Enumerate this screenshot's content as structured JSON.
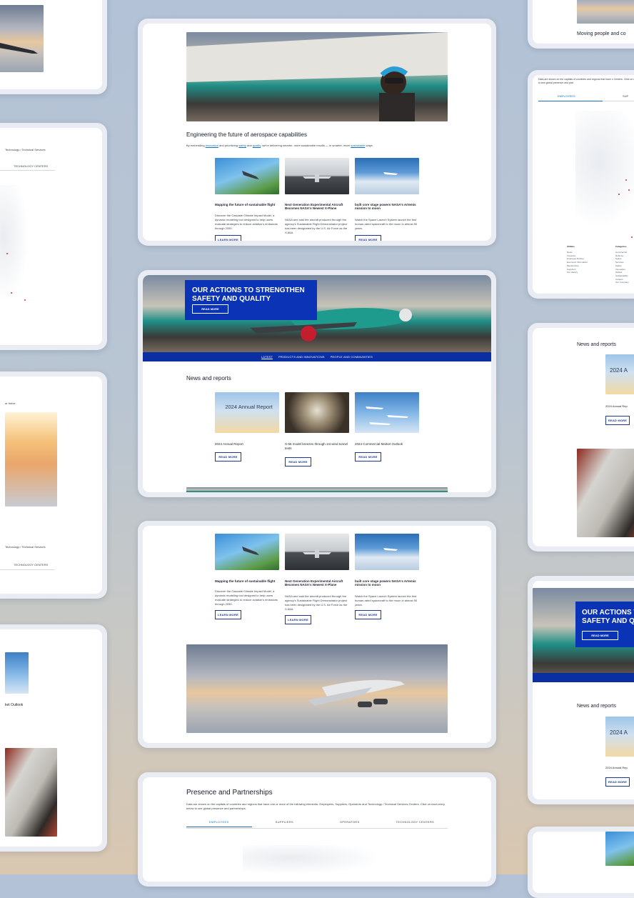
{
  "colors": {
    "brand_blue": "#0b33b6",
    "link_blue": "#1b6fb5",
    "button_border": "#1b3a8f"
  },
  "card1": {
    "title": "Engineering the future of aerospace capabilities",
    "intro_pre": "By embedding ",
    "intro_link1": "innovation",
    "intro_mid1": " and prioritizing ",
    "intro_link2": "safety",
    "intro_mid2": " and ",
    "intro_link3": "quality",
    "intro_mid3": ", we're delivering smarter, more sustainable results — in smarter, more ",
    "intro_link4": "sustainable",
    "intro_end": " ways.",
    "articles": [
      {
        "title": "Mapping the future of sustainable flight",
        "body": "Discover the Cascade Climate Impact Model, a dynamic modeling tool designed to help users evaluate strategies to reduce aviation's emissions through 2050.",
        "button": "LEARN MORE"
      },
      {
        "title": "Next Generation Experimental Aircraft Becomes NASA's Newest X-Plane",
        "body": "NASA and said the aircraft produced through the agency's Sustainable Flight Demonstrator project has been designated by the U.S. Air Force as the X-66A.",
        "button": "LEARN MORE"
      },
      {
        "title": "built core stage powers NASA's Artemis mission to moon",
        "body": "Watch the Space Launch System launch the first human-rated spacecraft to the moon in almost 50 years.",
        "button": "READ MORE"
      }
    ]
  },
  "card2": {
    "hero_title": "OUR ACTIONS TO STRENGTHEN SAFETY AND QUALITY",
    "hero_button": "READ MORE",
    "tabs": [
      "LATEST",
      "PRODUCTS AND INNOVATIONS",
      "PEOPLE AND COMMUNITIES"
    ],
    "section_title": "News and reports",
    "items": [
      {
        "title": "2024 Annual Report",
        "image_text": "2024 Annual Report",
        "button": "READ MORE"
      },
      {
        "title": "X-66 model breezes through 1st wind tunnel tests",
        "button": "READ MORE"
      },
      {
        "title": "2024 Commercial Market Outlook",
        "button": "READ MORE"
      }
    ]
  },
  "card3": {
    "articles": [
      {
        "title": "Mapping the future of sustainable flight",
        "body": "Discover the Cascade Climate Impact Model, a dynamic modeling tool designed to help users evaluate strategies to reduce aviation's emissions through 2050.",
        "button": "LEARN MORE"
      },
      {
        "title": "Next Generation Experimental Aircraft Becomes NASA's Newest X-Plane",
        "body": "NASA and said the aircraft produced through the agency's Sustainable Flight Demonstrator project has been designated by the U.S. Air Force as the X-66A.",
        "button": "LEARN MORE"
      },
      {
        "title": "built core stage powers NASA's Artemis mission to moon",
        "body": "Watch the Space Launch System launch the first human-rated spacecraft to the moon in almost 50 years.",
        "button": "READ MORE"
      }
    ]
  },
  "card4": {
    "title": "Presence and Partnerships",
    "desc": "Data are shown on the capitals of countries and regions that have one or more of the following elements: Employees, Suppliers, Operators and Technology / Technical Services Centers. Click on each entry below to see global presence and partnerships.",
    "tabs": [
      "EMPLOYEES",
      "SUPPLIERS",
      "OPERATORS",
      "TECHNOLOGY CENTERS"
    ]
  },
  "left": {
    "tech_label": "Technology / Technical Services",
    "tech_tab": "TECHNOLOGY CENTERS",
    "thrive": "ar thrive.",
    "tech_label2": "Technology / Technical Services",
    "tech_tab2": "TECHNOLOGY CENTERS",
    "outlook": "ket Outlook"
  },
  "right": {
    "moving": "Moving people and co",
    "desc": "Data are shown on the capitals of countries and regions that have o Centers. Click on each entry below to see global presence and part",
    "tab1": "EMPLOYEES",
    "tab2": "SUP",
    "col1_title": "Utilities",
    "col1": [
      "News",
      "Investors",
      "Employee Retiree",
      "Economic Information",
      "Membership",
      "Suppliers",
      "Our History"
    ],
    "col2_title": "Categories",
    "col2": [
      "Commercial",
      "Defense",
      "Space",
      "Services",
      "Safety",
      "Innovation",
      "Global",
      "Sustainability",
      "Careers",
      "Our Company"
    ],
    "news_title": "News and reports",
    "report_text": "2024 A",
    "report_caption": "2024 Annual Rep",
    "read_more": "READ MORE",
    "hero_text": "OUR ACTIONS T SAFETY AND Q",
    "news_title2": "News and reports",
    "report_caption2": "2024 Annual Rep",
    "read_more2": "READ MORE"
  }
}
